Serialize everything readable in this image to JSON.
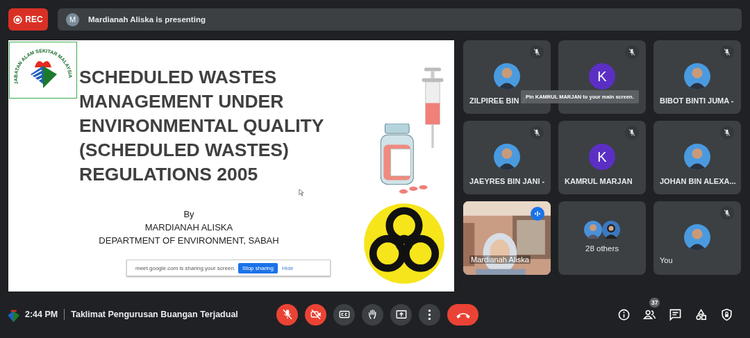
{
  "recording": {
    "label": "REC"
  },
  "presenting": {
    "initial": "M",
    "text": "Mardianah Aliska is presenting"
  },
  "slide": {
    "logo_text": "JABATAN ALAM SEKITAR MALAYSIA",
    "title_lines": [
      "SCHEDULED WASTES",
      "MANAGEMENT UNDER",
      "ENVIRONMENTAL QUALITY",
      "(SCHEDULED WASTES)",
      "REGULATIONS 2005"
    ],
    "by": "By",
    "author": "MARDIANAH ALISKA",
    "department": "DEPARTMENT OF ENVIRONMENT, SABAH",
    "share_bar": {
      "message": "meet.google.com is sharing your screen.",
      "stop": "Stop sharing",
      "hide": "Hide"
    }
  },
  "tooltip": "Pin KAMRUL MARJAN to your main screen.",
  "tiles": [
    {
      "name": "ZILPIREE BIN J",
      "muted": true,
      "speaking": false
    },
    {
      "kind": "letter",
      "initial": "K",
      "muted": true,
      "speaking": false
    },
    {
      "name": "BIBOT BINTI JUMA -",
      "muted": true,
      "speaking": false
    },
    {
      "name": "JAEYRES BIN JANI -",
      "muted": true,
      "speaking": false
    },
    {
      "kind": "letter",
      "initial": "K",
      "name": "KAMRUL MARJAN",
      "muted": true,
      "speaking": false
    },
    {
      "name": "JOHAN BIN ALEXA...",
      "muted": true,
      "speaking": false
    },
    {
      "kind": "video",
      "name": "Mardianah Aliska",
      "muted": false,
      "speaking": true
    },
    {
      "kind": "others",
      "count": "28 others",
      "muted": false,
      "speaking": false
    },
    {
      "kind": "self",
      "name": "You",
      "muted": true,
      "speaking": false
    }
  ],
  "meeting": {
    "time": "2:44 PM",
    "title": "Taklimat Pengurusan Buangan Terjadual"
  },
  "controls": [
    {
      "kind": "mic",
      "off": true
    },
    {
      "kind": "camera",
      "off": true
    },
    {
      "kind": "captions",
      "off": false
    },
    {
      "kind": "hand",
      "off": false
    },
    {
      "kind": "present",
      "off": false
    },
    {
      "kind": "more",
      "off": false
    },
    {
      "kind": "end"
    }
  ],
  "side_controls": [
    {
      "kind": "info"
    },
    {
      "kind": "people",
      "badge": "37"
    },
    {
      "kind": "chat"
    },
    {
      "kind": "activities"
    },
    {
      "kind": "host"
    }
  ]
}
